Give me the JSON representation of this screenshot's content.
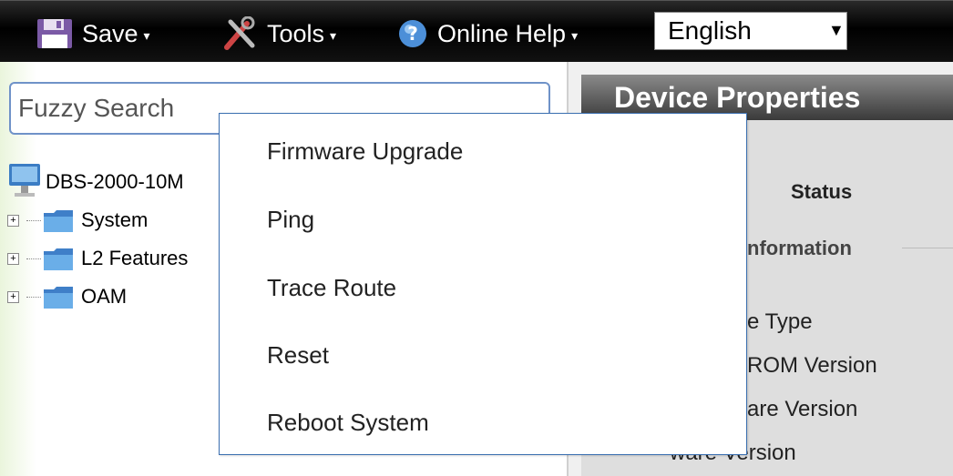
{
  "toolbar": {
    "save_label": "Save",
    "tools_label": "Tools",
    "help_label": "Online Help",
    "language_value": "English",
    "caret_glyph": "▾",
    "select_caret_glyph": "▼"
  },
  "search": {
    "placeholder": "Fuzzy Search"
  },
  "tree": {
    "root_label": "DBS-2000-10M",
    "items": [
      {
        "label": "System"
      },
      {
        "label": "L2 Features"
      },
      {
        "label": "OAM"
      }
    ]
  },
  "device_panel": {
    "title": "Device Properties",
    "status_label": "Status",
    "info_fragment": "nformation",
    "row_fragments": [
      "e Type",
      "ROM Version",
      "are Version",
      "ware Version"
    ]
  },
  "tools_menu": {
    "items": [
      {
        "label": "Firmware Upgrade"
      },
      {
        "label": "Ping"
      },
      {
        "label": "Trace Route"
      },
      {
        "label": "Reset"
      },
      {
        "label": "Reboot System"
      }
    ]
  },
  "colors": {
    "toolbar_bg": "#000000",
    "menu_border": "#3a6fb0",
    "search_border": "#6f92c8",
    "panel_title_bg": "#5a5a5a"
  }
}
